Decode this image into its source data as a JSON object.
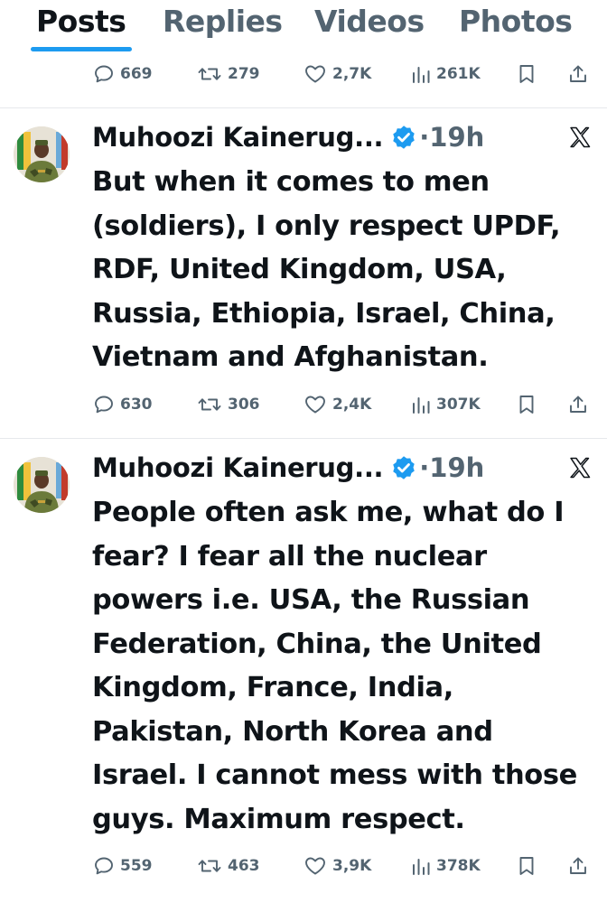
{
  "tabs": [
    "Posts",
    "Replies",
    "Videos",
    "Photos"
  ],
  "active_tab": "Posts",
  "top_partial_post": {
    "stats": {
      "replies": "669",
      "reposts": "279",
      "likes": "2,7K",
      "views": "261K"
    }
  },
  "posts": [
    {
      "author": "Muhoozi Kainerug...",
      "time": "19h",
      "separator": "·",
      "verified": true,
      "text_lines": [
        "But when it comes to men",
        "(soldiers), I only respect UPDF,",
        "RDF, United Kingdom, USA,",
        "Russia, Ethiopia, Israel, China,",
        "Vietnam and Afghanistan."
      ],
      "stats": {
        "replies": "630",
        "reposts": "306",
        "likes": "2,4K",
        "views": "307K"
      }
    },
    {
      "author": "Muhoozi Kainerug...",
      "time": "19h",
      "separator": "·",
      "verified": true,
      "text_lines": [
        "People often ask me, what do I",
        "fear? I fear all the nuclear",
        "powers i.e. USA, the Russian",
        "Federation, China, the United",
        "Kingdom, France, India,",
        "Pakistan, North Korea and",
        "Israel. I cannot mess with those",
        "guys. Maximum respect."
      ],
      "stats": {
        "replies": "559",
        "reposts": "463",
        "likes": "3,9K",
        "views": "378K"
      }
    }
  ],
  "icons": {
    "reply": "speech-bubble-icon",
    "repost": "repost-arrows-icon",
    "like": "heart-icon",
    "views": "bar-chart-icon",
    "bookmark": "bookmark-icon",
    "share": "share-upload-icon",
    "verified": "verified-badge-icon",
    "platform": "x-logo-icon"
  },
  "colors": {
    "accent": "#1d9bf0",
    "text": "#0f1419",
    "muted": "#536471",
    "divider": "#e6e9ec"
  }
}
